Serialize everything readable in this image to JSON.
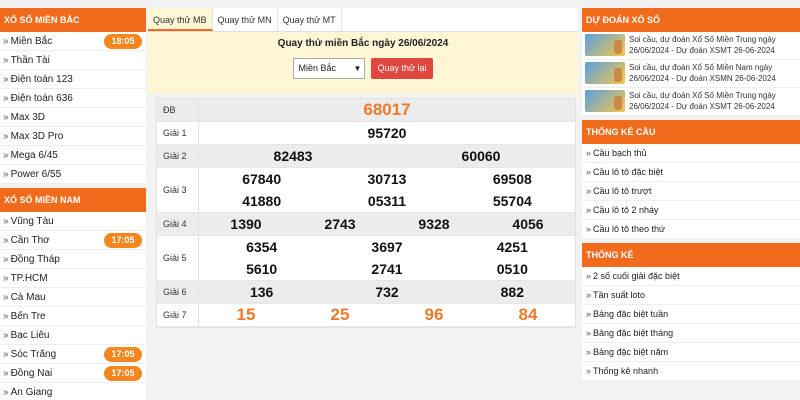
{
  "left": {
    "north": {
      "title": "Xổ Số Miền Bắc",
      "items": [
        {
          "label": "Miền Bắc",
          "time": "18:05"
        },
        {
          "label": "Thần Tài"
        },
        {
          "label": "Điện toán 123"
        },
        {
          "label": "Điện toán 636"
        },
        {
          "label": "Max 3D"
        },
        {
          "label": "Max 3D Pro"
        },
        {
          "label": "Mega 6/45"
        },
        {
          "label": "Power 6/55"
        }
      ]
    },
    "south": {
      "title": "Xổ Số Miền Nam",
      "items": [
        {
          "label": "Vũng Tàu"
        },
        {
          "label": "Cần Thơ",
          "time": "17:05"
        },
        {
          "label": "Đồng Tháp"
        },
        {
          "label": "TP.HCM"
        },
        {
          "label": "Cà Mau"
        },
        {
          "label": "Bến Tre"
        },
        {
          "label": "Bạc Liêu"
        },
        {
          "label": "Sóc Trăng",
          "time": "17:05"
        },
        {
          "label": "Đồng Nai",
          "time": "17:05"
        },
        {
          "label": "An Giang"
        }
      ]
    }
  },
  "center": {
    "tabs": [
      "Quay thử MB",
      "Quay thử MN",
      "Quay thử MT"
    ],
    "spin": {
      "title": "Quay thử miền Bắc ngày 26/06/2024",
      "select_value": "Miền Bắc",
      "button": "Quay thử lại"
    },
    "results": [
      {
        "label": "ĐB",
        "nums": [
          "68017"
        ],
        "cols": 1,
        "orange": true,
        "big": true
      },
      {
        "label": "Giải 1",
        "nums": [
          "95720"
        ],
        "cols": 1
      },
      {
        "label": "Giải 2",
        "nums": [
          "82483",
          "60060"
        ],
        "cols": 2
      },
      {
        "label": "Giải 3",
        "nums": [
          "67840",
          "30713",
          "69508",
          "41880",
          "05311",
          "55704"
        ],
        "cols": 3
      },
      {
        "label": "Giải 4",
        "nums": [
          "1390",
          "2743",
          "9328",
          "4056"
        ],
        "cols": 4
      },
      {
        "label": "Giải 5",
        "nums": [
          "6354",
          "3697",
          "4251",
          "5610",
          "2741",
          "0510"
        ],
        "cols": 3
      },
      {
        "label": "Giải 6",
        "nums": [
          "136",
          "732",
          "882"
        ],
        "cols": 3
      },
      {
        "label": "Giải 7",
        "nums": [
          "15",
          "25",
          "96",
          "84"
        ],
        "cols": 4,
        "orange": true,
        "big": true
      }
    ]
  },
  "right": {
    "predict": {
      "title": "Dự đoán xổ số",
      "items": [
        {
          "line1": "Soi cầu, dự đoán Xổ Số Miền Trung ngày",
          "line2": "26/06/2024 - Dự đoán XSMT 26-06-2024"
        },
        {
          "line1": "Soi cầu, dự đoán Xổ Số Miền Nam ngày",
          "line2": "26/06/2024 - Dự đoán XSMN 26-06-2024"
        },
        {
          "line1": "Soi cầu, dự đoán Xổ Số Miền Trung ngày",
          "line2": "26/06/2024 - Dự đoán XSMT 26-06-2024"
        }
      ]
    },
    "cau": {
      "title": "Thống kê cầu",
      "items": [
        "Cầu bạch thủ",
        "Cầu lô tô đặc biệt",
        "Cầu lô tô trượt",
        "Cầu lô tô 2 nháy",
        "Cầu lô tô theo thứ"
      ]
    },
    "stats": {
      "title": "Thống kê",
      "items": [
        "2 số cuối giải đặc biệt",
        "Tần suất loto",
        "Bảng đặc biệt tuần",
        "Bảng đặc biệt tháng",
        "Bảng đặc biệt năm",
        "Thống kê nhanh"
      ]
    }
  }
}
